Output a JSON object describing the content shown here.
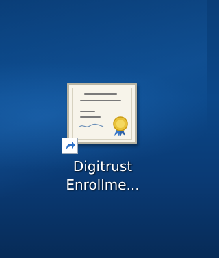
{
  "desktop": {
    "icon": {
      "label_line1": "Digitrust",
      "label_line2": "Enrollme...",
      "icon_name": "certificate-icon",
      "badge_icon_name": "shortcut-arrow-icon"
    }
  },
  "colors": {
    "wallpaper": "#0b4788",
    "certificate_paper": "#f7f4ea",
    "seal_gold": "#e9c23a",
    "seal_ribbon": "#3a78c8"
  }
}
